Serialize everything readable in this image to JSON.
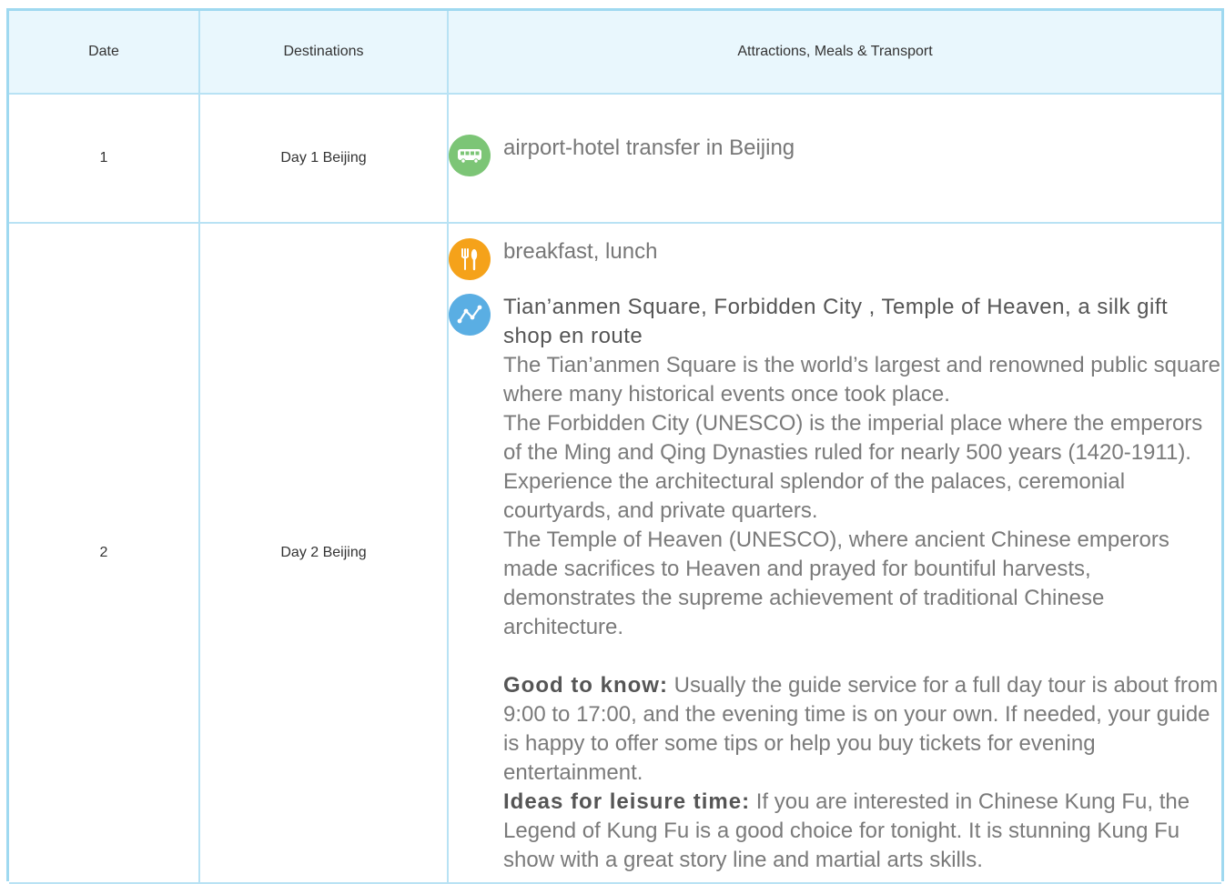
{
  "table": {
    "headers": {
      "date": "Date",
      "destinations": "Destinations",
      "details": "Attractions, Meals & Transport"
    },
    "rows": [
      {
        "date": "1",
        "destination": "Day 1 Beijing",
        "items": [
          {
            "icon": "bus-icon",
            "text": "airport-hotel transfer in Beijing"
          }
        ]
      },
      {
        "date": "2",
        "destination": "Day 2 Beijing",
        "meal": {
          "icon": "meal-icon",
          "text": "breakfast, lunch"
        },
        "attraction": {
          "icon": "route-icon",
          "title": "Tian’anmen Square, Forbidden City , Temple of Heaven, a silk gift shop en route",
          "paragraphs": [
            "The Tian’anmen Square is the world’s largest and renowned public square where many historical events once took place.",
            "The Forbidden City (UNESCO) is the imperial place where the emperors of the Ming and Qing Dynasties ruled for nearly 500 years (1420-1911). Experience the architectural splendor of the palaces, ceremonial courtyards, and private quarters.",
            "The Temple of Heaven (UNESCO), where ancient Chinese emperors made sacrifices to Heaven and prayed for bountiful harvests, demonstrates the supreme achievement of traditional Chinese architecture."
          ],
          "good_to_know_label": "Good to know:",
          "good_to_know_text": "Usually the guide service for a full day tour is about from 9:00 to 17:00, and the evening time is on your own. If needed, your guide is happy to offer some tips or help you buy tickets for evening entertainment.",
          "leisure_label": "Ideas for leisure time:",
          "leisure_text": "If you are interested in Chinese Kung Fu, the Legend of Kung Fu is a good choice for tonight. It is stunning Kung Fu show with a great story line and martial arts skills."
        }
      }
    ]
  },
  "colors": {
    "border": "#b8e2f4",
    "header_bg": "#e9f7fd",
    "bus_icon": "#7cc576",
    "meal_icon": "#f5a21a",
    "route_icon": "#5aaee3"
  }
}
